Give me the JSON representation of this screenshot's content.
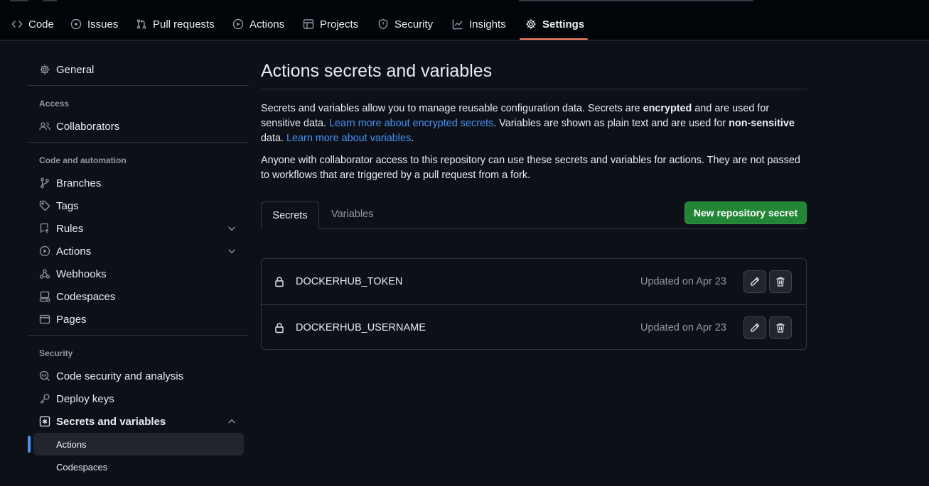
{
  "repo_nav": {
    "items": [
      {
        "label": "Code",
        "icon": "code-icon"
      },
      {
        "label": "Issues",
        "icon": "issue-opened-icon"
      },
      {
        "label": "Pull requests",
        "icon": "git-pull-request-icon"
      },
      {
        "label": "Actions",
        "icon": "play-icon"
      },
      {
        "label": "Projects",
        "icon": "table-icon"
      },
      {
        "label": "Security",
        "icon": "shield-icon"
      },
      {
        "label": "Insights",
        "icon": "graph-icon"
      },
      {
        "label": "Settings",
        "icon": "gear-icon"
      }
    ],
    "active": "Settings"
  },
  "sidebar": {
    "general": "General",
    "sections": [
      {
        "heading": "Access",
        "items": [
          "Collaborators"
        ]
      },
      {
        "heading": "Code and automation",
        "items": [
          "Branches",
          "Tags",
          "Rules",
          "Actions",
          "Webhooks",
          "Codespaces",
          "Pages"
        ]
      },
      {
        "heading": "Security",
        "items": [
          "Code security and analysis",
          "Deploy keys",
          "Secrets and variables"
        ]
      }
    ],
    "subitems": [
      "Actions",
      "Codespaces"
    ],
    "active_subitem": "Actions"
  },
  "main": {
    "title": "Actions secrets and variables",
    "intro": {
      "p1_a": "Secrets and variables allow you to manage reusable configuration data. Secrets are ",
      "p1_b": "encrypted",
      "p1_c": " and are used for sensitive data. ",
      "link1": "Learn more about encrypted secrets",
      "p1_d": ". Variables are shown as plain text and are used for ",
      "p1_e": "non-sensitive",
      "p1_f": " data. ",
      "link2": "Learn more about variables",
      "p1_g": "."
    },
    "p2": "Anyone with collaborator access to this repository can use these secrets and variables for actions. They are not passed to workflows that are triggered by a pull request from a fork.",
    "tabs": [
      "Secrets",
      "Variables"
    ],
    "active_tab": "Secrets",
    "new_button": "New repository secret",
    "secrets": [
      {
        "name": "DOCKERHUB_TOKEN",
        "updated": "Updated on Apr 23"
      },
      {
        "name": "DOCKERHUB_USERNAME",
        "updated": "Updated on Apr 23"
      }
    ]
  },
  "colors": {
    "background": "#0d1117",
    "accent_link": "#4493f8",
    "primary_button": "#238636",
    "active_tab_underline": "#f78166"
  }
}
